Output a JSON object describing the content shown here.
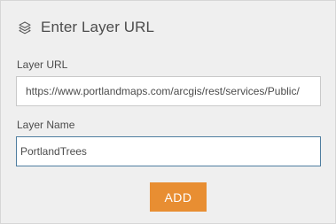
{
  "header": {
    "icon": "layers-icon",
    "title": "Enter Layer URL"
  },
  "form": {
    "url_label": "Layer URL",
    "url_value": "https://www.portlandmaps.com/arcgis/rest/services/Public/",
    "name_label": "Layer Name",
    "name_value": "PortlandTrees"
  },
  "actions": {
    "add_label": "ADD"
  },
  "colors": {
    "accent": "#e88e32",
    "focus_border": "#4f7ea0",
    "panel_bg": "#efefef"
  }
}
